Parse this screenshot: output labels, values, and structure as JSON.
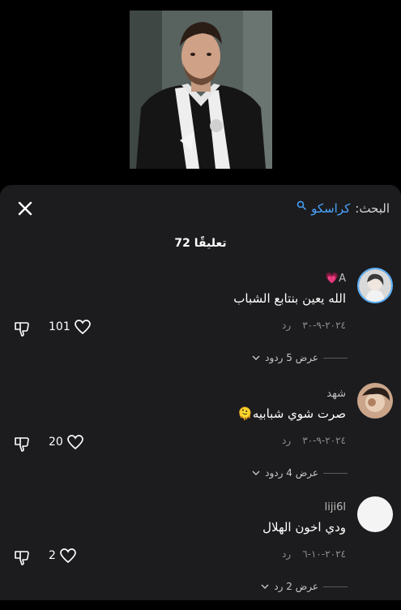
{
  "search": {
    "label": "البحث:",
    "term": "كراسكو"
  },
  "comments_count": "72 تعليقًا",
  "comments": [
    {
      "user": "A💗",
      "text": "الله يعين بنتابع الشباب",
      "date": "٢٠٢٤-٩-٣٠",
      "reply": "رد",
      "likes": "101",
      "replies": "عرض 5 ردود"
    },
    {
      "user": "شهد",
      "text": "صرت شوي شبابيه🫠",
      "date": "٢٠٢٤-٩-٣٠",
      "reply": "رد",
      "likes": "20",
      "replies": "عرض 4 ردود"
    },
    {
      "user": "liji6l",
      "text": "ودي اخون الهلال",
      "date": "٢٠٢٤-١٠-٦",
      "reply": "رد",
      "likes": "2",
      "replies": "عرض 2 رد"
    }
  ],
  "colors": {
    "sheet": "#1c1c1e",
    "accent": "#4aa3ff",
    "muted": "#8e8e93"
  }
}
